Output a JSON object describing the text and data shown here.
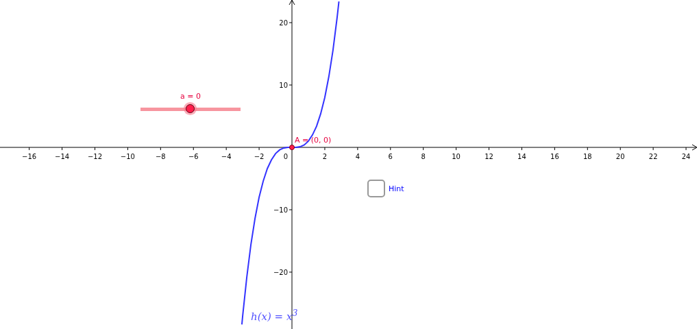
{
  "graph": {
    "chart_data": {
      "type": "line",
      "xlim": [
        -17.78,
        24.79
      ],
      "ylim": [
        -29.12,
        23.63
      ],
      "xticks": [
        {
          "value": -16,
          "label": "−16"
        },
        {
          "value": -14,
          "label": "−14"
        },
        {
          "value": -12,
          "label": "−12"
        },
        {
          "value": -10,
          "label": "−10"
        },
        {
          "value": -8,
          "label": "−8"
        },
        {
          "value": -6,
          "label": "−6"
        },
        {
          "value": -4,
          "label": "−4"
        },
        {
          "value": -2,
          "label": "−2"
        },
        {
          "value": 2,
          "label": "2"
        },
        {
          "value": 4,
          "label": "4"
        },
        {
          "value": 6,
          "label": "6"
        },
        {
          "value": 8,
          "label": "8"
        },
        {
          "value": 10,
          "label": "10"
        },
        {
          "value": 12,
          "label": "12"
        },
        {
          "value": 14,
          "label": "14"
        },
        {
          "value": 16,
          "label": "16"
        },
        {
          "value": 18,
          "label": "18"
        },
        {
          "value": 20,
          "label": "20"
        },
        {
          "value": 22,
          "label": "22"
        },
        {
          "value": 24,
          "label": "24"
        }
      ],
      "yticks": [
        {
          "value": -20,
          "label": "−20"
        },
        {
          "value": -10,
          "label": "−10"
        },
        {
          "value": 10,
          "label": "10"
        },
        {
          "value": 20,
          "label": "20"
        }
      ],
      "x": [
        -3.05,
        -3,
        -2.75,
        -2.5,
        -2.25,
        -2,
        -1.75,
        -1.5,
        -1.25,
        -1,
        -0.75,
        -0.5,
        -0.25,
        0,
        0.25,
        0.5,
        0.75,
        1,
        1.25,
        1.5,
        1.75,
        2,
        2.25,
        2.5,
        2.75,
        2.86
      ],
      "series": [
        {
          "name": "h(x) = x$^{3}$",
          "color": "#3333ff",
          "values": [
            -28.4,
            -27,
            -20.8,
            -15.6,
            -11.4,
            -8,
            -5.4,
            -3.4,
            -2,
            -1,
            -0.4,
            -0.1,
            0,
            0,
            0,
            0.1,
            0.4,
            1,
            2,
            3.4,
            5.4,
            8,
            11.4,
            15.6,
            20.8,
            23.4
          ]
        }
      ]
    },
    "origin_label": "0"
  },
  "slider": {
    "label": "a = 0",
    "level": 0.5
  },
  "point": {
    "label": "A = (0, 0)"
  },
  "checkbox": {
    "label": "Hint",
    "checked": false
  }
}
